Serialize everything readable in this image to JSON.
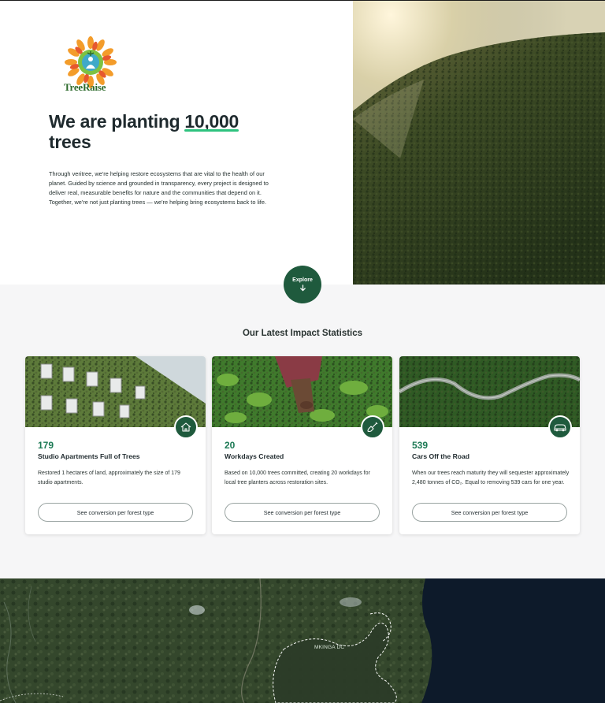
{
  "brand": {
    "name": "TreeRaise"
  },
  "hero": {
    "title_prefix": "We are planting ",
    "title_highlight": "10,000",
    "title_suffix": "trees",
    "body": "Through veritree, we're helping restore ecosystems that are vital to the health of our planet. Guided by science and grounded in transparency, every project is designed to deliver real, measurable benefits for nature and the communities that depend on it. Together, we're not just planting trees — we're helping bring ecosystems back to life.",
    "explore_label": "Explore"
  },
  "stats": {
    "title": "Our Latest Impact Statistics",
    "cards": [
      {
        "value": "179",
        "label": "Studio Apartments Full of Trees",
        "description": "Restored 1 hectares of land, approximately the size of 179 studio apartments.",
        "cta": "See conversion per forest type",
        "icon": "house-icon"
      },
      {
        "value": "20",
        "label": "Workdays Created",
        "description": "Based on 10,000 trees committed, creating 20 workdays for local tree planters across restoration sites.",
        "cta": "See conversion per forest type",
        "icon": "shovel-icon"
      },
      {
        "value": "539",
        "label": "Cars Off the Road",
        "description": "When our trees reach maturity they will sequester approximately 2,480 tonnes of CO₂. Equal to removing 539 cars for one year.",
        "cta": "See conversion per forest type",
        "icon": "car-icon"
      }
    ]
  },
  "map": {
    "region_label": "MKINGA DC"
  },
  "colors": {
    "primary_green": "#1f5a3d",
    "accent_green": "#2ec27e",
    "stat_green": "#1d7a55"
  }
}
